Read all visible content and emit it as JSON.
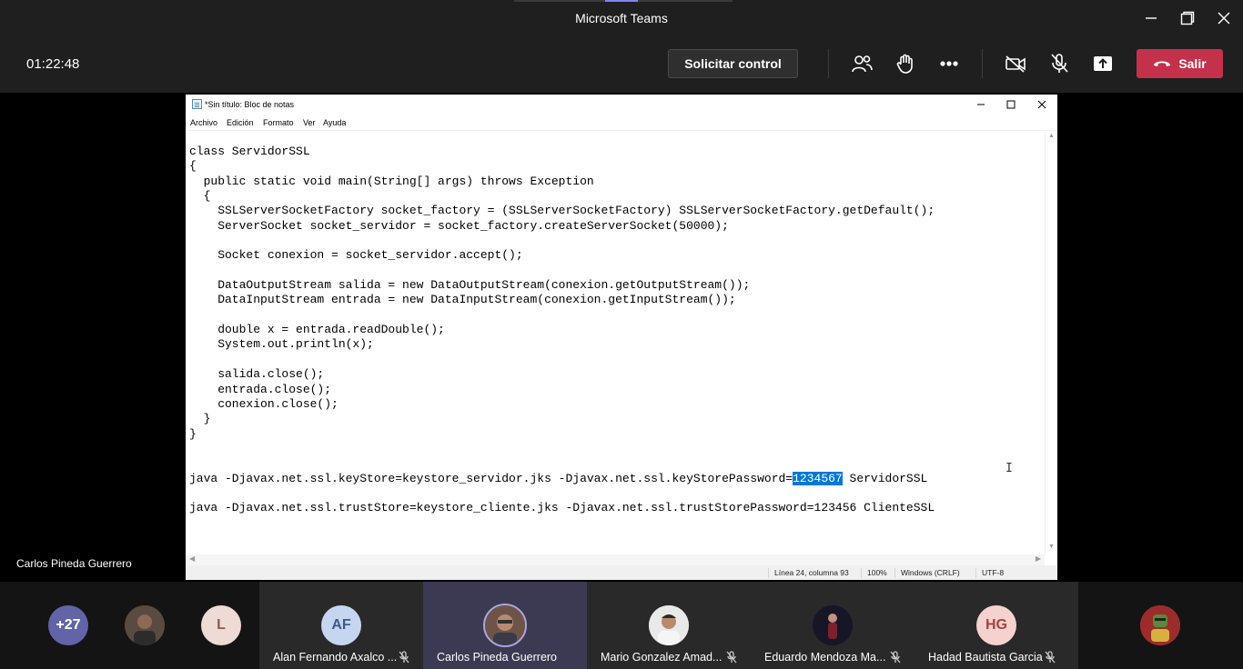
{
  "window": {
    "title": "Microsoft Teams"
  },
  "meeting": {
    "timer": "01:22:48",
    "request_control_label": "Solicitar control",
    "leave_label": "Salir",
    "leave_color": "#c4314b"
  },
  "stage": {
    "presenter_name": "Carlos Pineda Guerrero"
  },
  "notepad": {
    "title": "*Sin título: Bloc de notas",
    "menu": [
      "Archivo",
      "Edición",
      "Formato",
      "Ver",
      "Ayuda"
    ],
    "code_lines": [
      "class ServidorSSL",
      "{",
      "  public static void main(String[] args) throws Exception",
      "  {",
      "    SSLServerSocketFactory socket_factory = (SSLServerSocketFactory) SSLServerSocketFactory.getDefault();",
      "    ServerSocket socket_servidor = socket_factory.createServerSocket(50000);",
      "",
      "    Socket conexion = socket_servidor.accept();",
      "",
      "    DataOutputStream salida = new DataOutputStream(conexion.getOutputStream());",
      "    DataInputStream entrada = new DataInputStream(conexion.getInputStream());",
      "",
      "    double x = entrada.readDouble();",
      "    System.out.println(x);",
      "",
      "    salida.close();",
      "    entrada.close();",
      "    conexion.close();",
      "  }",
      "}",
      "",
      ""
    ],
    "cmd_server_before": "java -Djavax.net.ssl.keyStore=keystore_servidor.jks -Djavax.net.ssl.keyStorePassword=",
    "cmd_server_selected": "1234567",
    "cmd_server_after": " ServidorSSL",
    "cmd_client": "java -Djavax.net.ssl.trustStore=keystore_cliente.jks -Djavax.net.ssl.trustStorePassword=123456 ClienteSSL",
    "status": {
      "position": "Línea 24, columna 93",
      "zoom": "100%",
      "line_endings": "Windows (CRLF)",
      "encoding": "UTF-8"
    }
  },
  "participants": {
    "overflow_count": "+27",
    "overflow_color": "#6264a7",
    "l_initial": "L",
    "list": [
      {
        "name": "Alan Fernando Axalco ...",
        "initials": "AF",
        "avatar_color": "#c7d6f0",
        "text_color": "#3a5a8c",
        "muted": true
      },
      {
        "name": "Carlos Pineda Guerrero",
        "initials": "",
        "avatar_color": "#8a6a5a",
        "muted": false,
        "active": true
      },
      {
        "name": "Mario Gonzalez Amad...",
        "initials": "",
        "avatar_color": "#d9d9d9",
        "muted": true
      },
      {
        "name": "Eduardo Mendoza Ma...",
        "initials": "",
        "avatar_color": "#1b1b2a",
        "muted": true
      },
      {
        "name": "Hadad Bautista Garcia",
        "initials": "HG",
        "avatar_color": "#f6d2cf",
        "text_color": "#a3423c",
        "muted": true
      }
    ]
  }
}
